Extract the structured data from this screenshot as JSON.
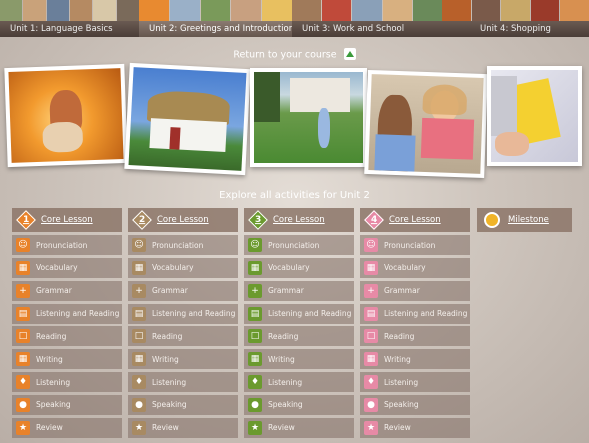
{
  "tabs": [
    {
      "label": "Unit 1: Language Basics",
      "active": false
    },
    {
      "label": "Unit 2: Greetings and Introductions",
      "active": true
    },
    {
      "label": "Unit 3: Work and School",
      "active": false
    },
    {
      "label": "Unit 4: Shopping",
      "active": false
    }
  ],
  "return_label": "Return to your course",
  "explore_label": "Explore all activities for Unit 2",
  "columns": [
    {
      "number": "1",
      "color": "#e8822a",
      "head": "Core Lesson",
      "items": [
        "Pronunciation",
        "Vocabulary",
        "Grammar",
        "Listening and Reading",
        "Reading",
        "Writing",
        "Listening",
        "Speaking",
        "Review"
      ]
    },
    {
      "number": "2",
      "color": "#a88a62",
      "head": "Core Lesson",
      "items": [
        "Pronunciation",
        "Vocabulary",
        "Grammar",
        "Listening and Reading",
        "Reading",
        "Writing",
        "Listening",
        "Speaking",
        "Review"
      ]
    },
    {
      "number": "3",
      "color": "#6b9a2e",
      "head": "Core Lesson",
      "items": [
        "Pronunciation",
        "Vocabulary",
        "Grammar",
        "Listening and Reading",
        "Reading",
        "Writing",
        "Listening",
        "Speaking",
        "Review"
      ]
    },
    {
      "number": "4",
      "color": "#e78aa6",
      "head": "Core Lesson",
      "items": [
        "Pronunciation",
        "Vocabulary",
        "Grammar",
        "Listening and Reading",
        "Reading",
        "Writing",
        "Listening",
        "Speaking",
        "Review"
      ]
    }
  ],
  "milestone_label": "Milestone",
  "icons": [
    "mouth-icon",
    "grid-icon",
    "plus-icon",
    "book-icon",
    "page-icon",
    "writing-grid-icon",
    "ear-icon",
    "speech-bubble-icon",
    "star-icon"
  ]
}
